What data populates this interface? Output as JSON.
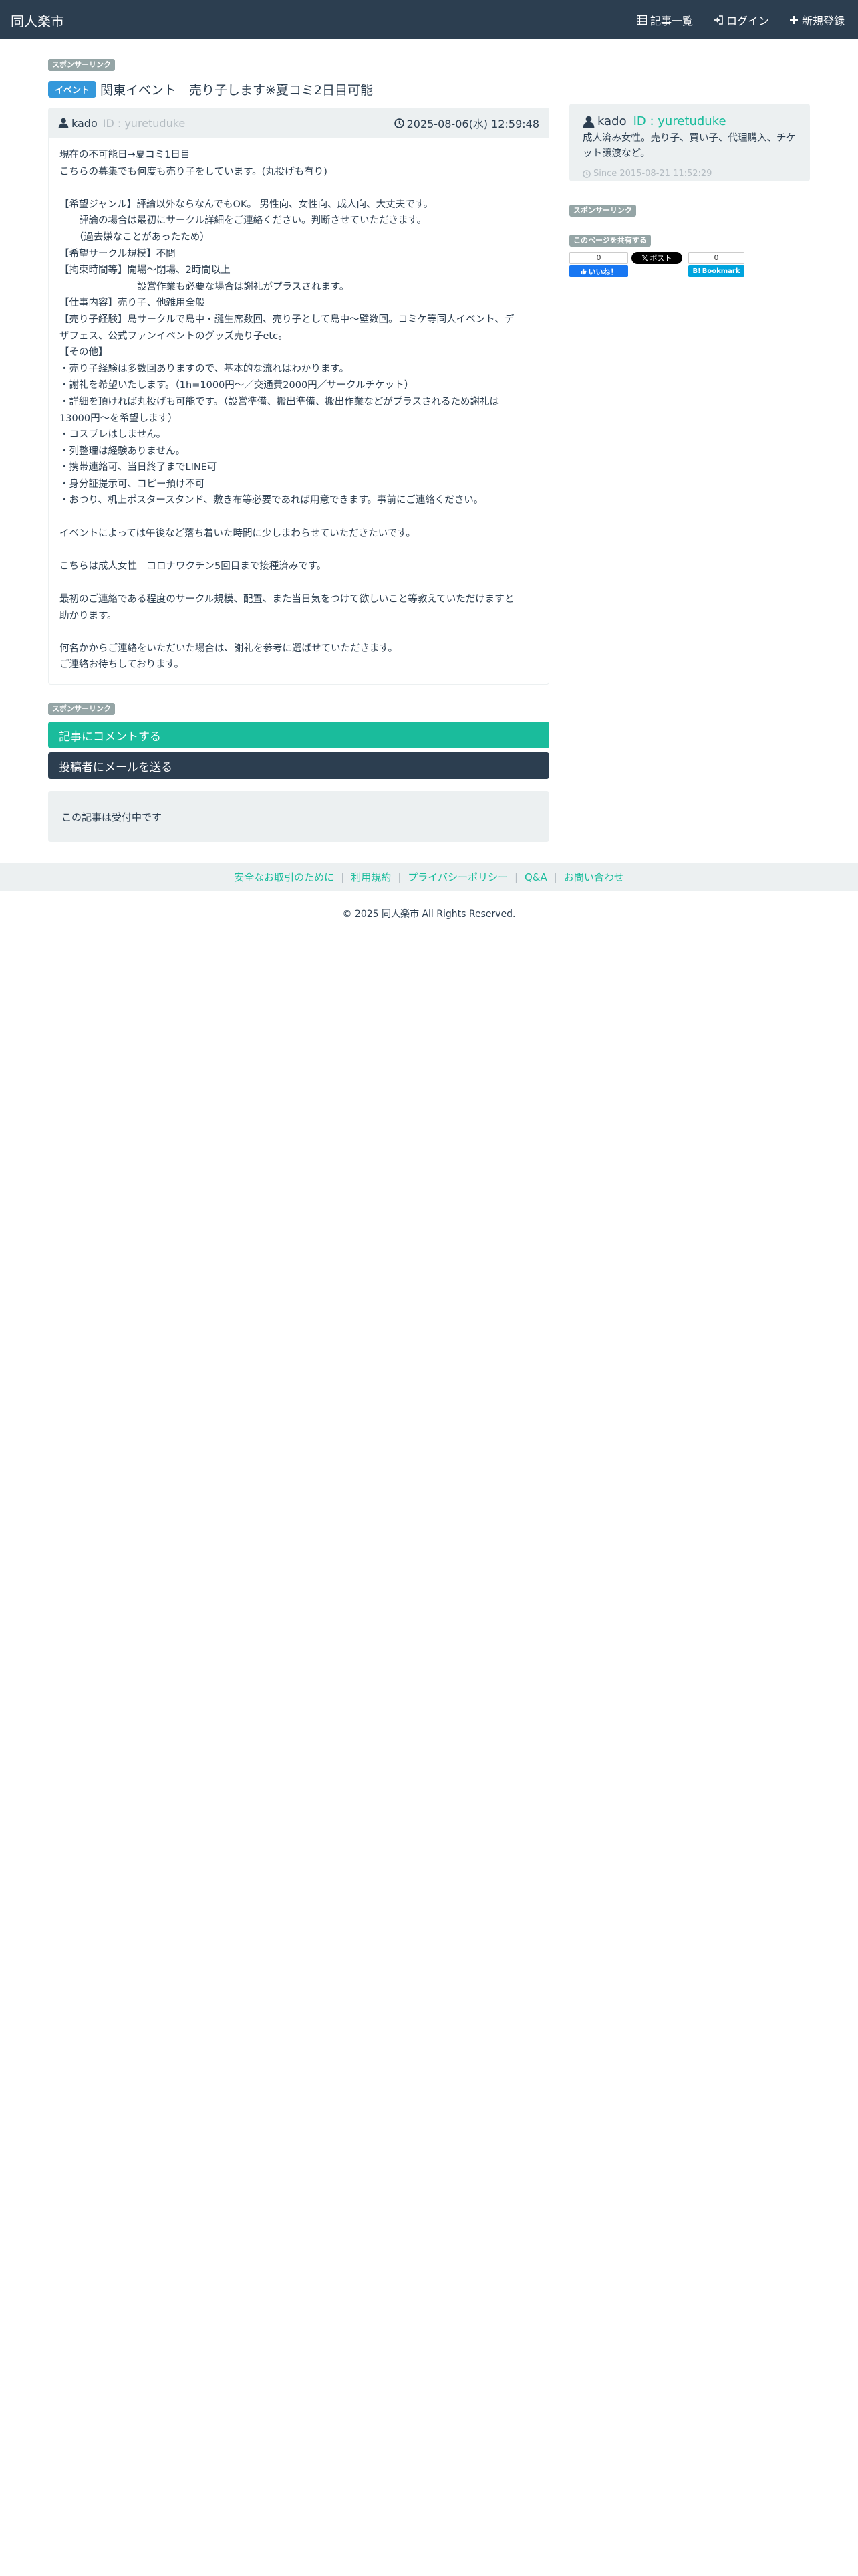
{
  "nav": {
    "brand": "同人楽市",
    "items": [
      {
        "label": "記事一覧",
        "icon": "list-icon"
      },
      {
        "label": "ログイン",
        "icon": "login-icon"
      },
      {
        "label": "新規登録",
        "icon": "plus-icon"
      }
    ]
  },
  "sponsor_label": "スポンサーリンク",
  "post": {
    "tag": "イベント",
    "title": "関東イベント　売り子します※夏コミ2日目可能",
    "author": "kado",
    "author_id": "ID : yuretuduke",
    "date": "2025-08-06(水) 12:59:48",
    "body": [
      "現在の不可能日→夏コミ1日目",
      "こちらの募集でも何度も売り子をしています。(丸投げも有り)",
      "",
      "【希望ジャンル】評論以外ならなんでもOK。 男性向、女性向、成人向、大丈夫です。",
      "　　評論の場合は最初にサークル詳細をご連絡ください。判断させていただきます。",
      "　　（過去嫌なことがあったため）",
      "【希望サークル規模】不問",
      "【拘束時間等】開場〜閉場、2時間以上",
      "　　　　　　　　設営作業も必要な場合は謝礼がプラスされます。",
      "【仕事内容】売り子、他雑用全般",
      "【売り子経験】島サークルで島中・誕生席数回、売り子として島中〜壁数回。コミケ等同人イベント、デ",
      "ザフェス、公式ファンイベントのグッズ売り子etc。",
      "【その他】",
      "・売り子経験は多数回ありますので、基本的な流れはわかります。",
      "・謝礼を希望いたします。（1h=1000円〜／交通費2000円／サークルチケット）",
      "・詳細を頂ければ丸投げも可能です。（設営準備、搬出準備、搬出作業などがプラスされるため謝礼は",
      "13000円〜を希望します）",
      "・コスプレはしません。",
      "・列整理は経験ありません。",
      "・携帯連絡可、当日終了までLINE可",
      "・身分証提示可、コピー預け不可",
      "・おつり、机上ポスタースタンド、敷き布等必要であれば用意できます。事前にご連絡ください。",
      "",
      "イベントによっては午後など落ち着いた時間に少しまわらせていただきたいです。",
      "",
      "こちらは成人女性　コロナワクチン5回目まで接種済みです。",
      "",
      "最初のご連絡である程度のサークル規模、配置、また当日気をつけて欲しいこと等教えていただけますと",
      "助かります。",
      "",
      "何名かからご連絡をいただいた場合は、謝礼を参考に選ばせていただきます。",
      "ご連絡お待ちしております。"
    ]
  },
  "actions": {
    "comment": "記事にコメントする",
    "mail": "投稿者にメールを送る"
  },
  "status": "この記事は受付中です",
  "profile": {
    "name": "kado",
    "id": "ID : yuretuduke",
    "desc": "成人済み女性。売り子、買い子、代理購入、チケット譲渡など。",
    "since": "Since 2015-08-21 11:52:29"
  },
  "share": {
    "label": "このページを共有する",
    "fb_count": "0",
    "fb_label": "いいね！",
    "x_label": "ポスト",
    "hb_count": "0",
    "hb_label": "Bookmark"
  },
  "footer": {
    "links": [
      "安全なお取引のために",
      "利用規約",
      "プライバシーポリシー",
      "Q&A",
      "お問い合わせ"
    ],
    "copyright": "© 2025 同人楽市 All Rights Reserved."
  },
  "colors": {
    "navbar": "#2c3e50",
    "accent": "#1abc9c",
    "event_tag": "#3498db",
    "well": "#ecf0f1"
  }
}
